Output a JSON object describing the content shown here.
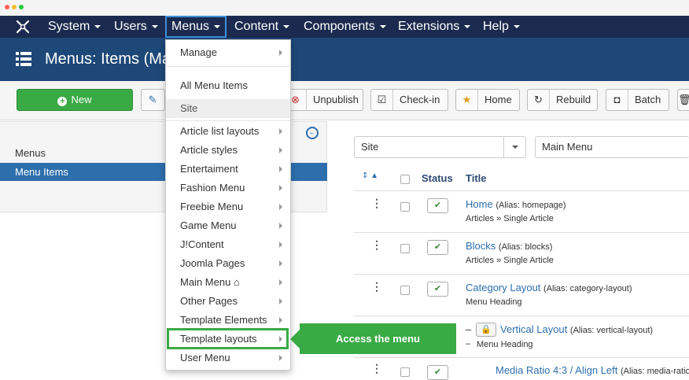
{
  "colors": {
    "navbar": "#1b2a4e",
    "header": "#1e4878",
    "accent": "#2d6ead",
    "green": "#3aaa45"
  },
  "nav": {
    "items": [
      {
        "label": "System"
      },
      {
        "label": "Users"
      },
      {
        "label": "Menus"
      },
      {
        "label": "Content"
      },
      {
        "label": "Components"
      },
      {
        "label": "Extensions"
      },
      {
        "label": "Help"
      }
    ]
  },
  "header": {
    "title": "Menus: Items (Ma"
  },
  "toolbar": {
    "new": "New",
    "unpublish": "Unpublish",
    "checkin": "Check-in",
    "home": "Home",
    "rebuild": "Rebuild",
    "batch": "Batch"
  },
  "sidebar": {
    "items": [
      {
        "label": "Menus"
      },
      {
        "label": "Menu Items"
      }
    ]
  },
  "filters": {
    "client": "Site",
    "menu": "Main Menu"
  },
  "table": {
    "headers": {
      "status": "Status",
      "title": "Title"
    },
    "rows": [
      {
        "title": "Home",
        "alias": "(Alias: homepage)",
        "type": "Articles » Single Article"
      },
      {
        "title": "Blocks",
        "alias": "(Alias: blocks)",
        "type": "Articles » Single Article"
      },
      {
        "title": "Category Layout",
        "alias": "(Alias: category-layout)",
        "type": "Menu Heading"
      },
      {
        "title": "Vertical Layout",
        "alias": "(Alias: vertical-layout)",
        "type": "Menu Heading",
        "prefix": "–",
        "subprefix": "–"
      },
      {
        "title": "Media Ratio 4:3 / Align Left",
        "alias": "(Alias: media-ratio..."
      }
    ]
  },
  "dropdown": {
    "manage": "Manage",
    "all_items": "All Menu Items",
    "site_header": "Site",
    "menus": [
      {
        "label": "Article list layouts"
      },
      {
        "label": "Article styles"
      },
      {
        "label": "Entertaiment"
      },
      {
        "label": "Fashion Menu"
      },
      {
        "label": "Freebie Menu"
      },
      {
        "label": "Game Menu"
      },
      {
        "label": "J!Content"
      },
      {
        "label": "Joomla Pages"
      },
      {
        "label": "Main Menu"
      },
      {
        "label": "Other Pages"
      },
      {
        "label": "Template Elements"
      },
      {
        "label": "Template layouts"
      },
      {
        "label": "User Menu"
      }
    ]
  },
  "callout": {
    "text": "Access the menu"
  }
}
